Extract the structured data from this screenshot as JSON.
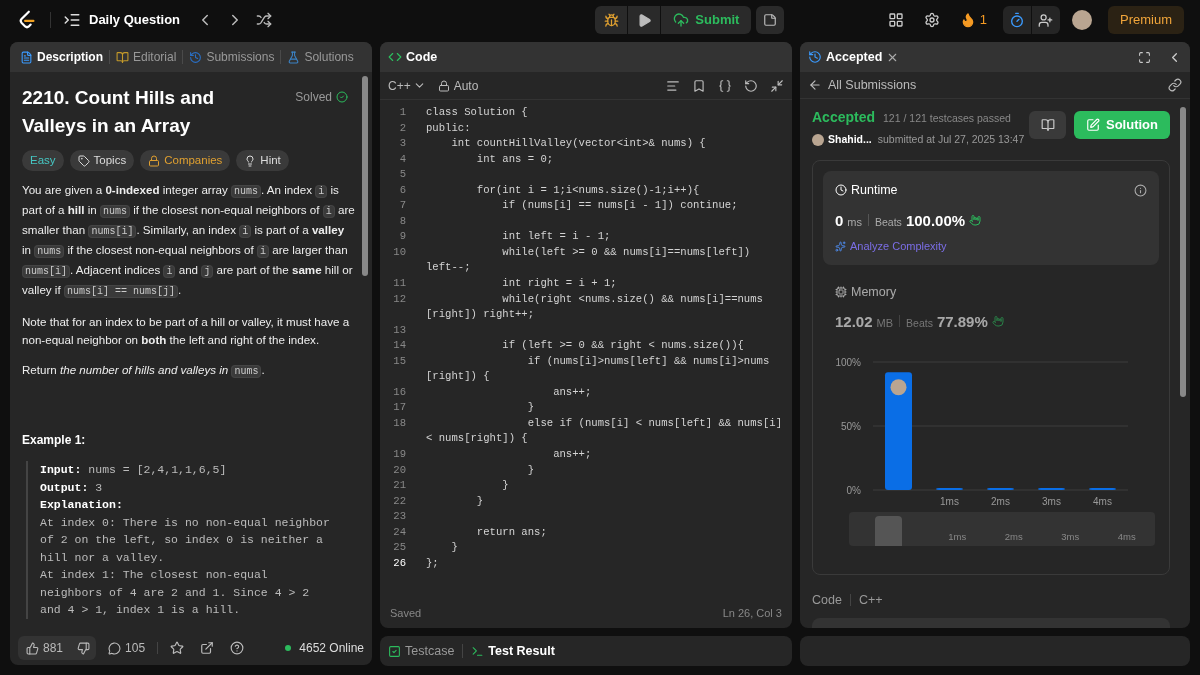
{
  "topbar": {
    "title": "Daily Question",
    "submit": "Submit",
    "streak": "1",
    "premium": "Premium"
  },
  "left_panel": {
    "tabs": [
      {
        "label": "Description",
        "kind": "description",
        "selected": true
      },
      {
        "label": "Editorial",
        "kind": "editorial",
        "selected": false
      },
      {
        "label": "Submissions",
        "kind": "submissions",
        "selected": false
      },
      {
        "label": "Solutions",
        "kind": "solutions",
        "selected": false
      }
    ],
    "title": "2210. Count Hills and Valleys in an Array",
    "status": "Solved",
    "tags": [
      {
        "label": "Easy",
        "kind": "difficulty"
      },
      {
        "label": "Topics",
        "kind": "topics"
      },
      {
        "label": "Companies",
        "kind": "companies"
      },
      {
        "label": "Hint",
        "kind": "hint"
      }
    ],
    "paragraphs": [
      [
        {
          "kind": "text",
          "text": "You are given a **0-indexed** integer array "
        },
        {
          "kind": "code",
          "text": "nums"
        },
        {
          "kind": "text",
          "text": ". An index "
        },
        {
          "kind": "code",
          "text": "i"
        },
        {
          "kind": "text",
          "text": " is part of a **hill** in "
        },
        {
          "kind": "code",
          "text": "nums"
        },
        {
          "kind": "text",
          "text": " if the closest non-equal neighbors of "
        },
        {
          "kind": "code",
          "text": "i"
        },
        {
          "kind": "text",
          "text": " are smaller than "
        },
        {
          "kind": "code",
          "text": "nums[i]"
        },
        {
          "kind": "text",
          "text": ". Similarly, an index "
        },
        {
          "kind": "code",
          "text": "i"
        },
        {
          "kind": "text",
          "text": " is part of a **valley** in "
        },
        {
          "kind": "code",
          "text": "nums"
        },
        {
          "kind": "text",
          "text": " if the closest non-equal neighbors of "
        },
        {
          "kind": "code",
          "text": "i"
        },
        {
          "kind": "text",
          "text": " are larger than "
        },
        {
          "kind": "code",
          "text": "nums[i]"
        },
        {
          "kind": "text",
          "text": ". Adjacent indices "
        },
        {
          "kind": "code",
          "text": "i"
        },
        {
          "kind": "text",
          "text": " and "
        },
        {
          "kind": "code",
          "text": "j"
        },
        {
          "kind": "text",
          "text": " are part of the **same** hill or valley if "
        },
        {
          "kind": "code",
          "text": "nums[i] == nums[j]"
        },
        {
          "kind": "text",
          "text": "."
        }
      ],
      [
        {
          "kind": "text",
          "text": "Note that for an index to be part of a hill or valley, it must have a non-equal neighbor on **both** the left and right of the index."
        }
      ],
      [
        {
          "kind": "text",
          "text": "Return *the number of hills and valleys in* "
        },
        {
          "kind": "code",
          "text": "nums"
        },
        {
          "kind": "text",
          "text": "."
        }
      ]
    ],
    "example_title": "Example 1:",
    "example_lines": [
      {
        "label": "Input:",
        "text": " nums = [2,4,1,1,6,5]"
      },
      {
        "label": "Output:",
        "text": " 3"
      },
      {
        "label": "Explanation:"
      },
      {
        "text": "At index 0: There is no non-equal neighbor"
      },
      {
        "text": "of 2 on the left, so index 0 is neither a"
      },
      {
        "text": "hill nor a valley."
      },
      {
        "text": "At index 1: The closest non-equal"
      },
      {
        "text": "neighbors of 4 are 2 and 1. Since 4 > 2"
      },
      {
        "text": "and 4 > 1, index 1 is a hill."
      }
    ],
    "footer": {
      "likes": "881",
      "comments": "105",
      "online": "4652 Online"
    }
  },
  "code_panel": {
    "title": "Code",
    "language": "C++",
    "mode": "Auto",
    "lines": [
      {
        "number": "1",
        "rows": [
          "class Solution {"
        ]
      },
      {
        "number": "2",
        "rows": [
          "public:"
        ]
      },
      {
        "number": "3",
        "rows": [
          "    int countHillValley(vector<int>& nums) {"
        ]
      },
      {
        "number": "4",
        "rows": [
          "        int ans = 0;"
        ]
      },
      {
        "number": "5"
      },
      {
        "number": "6",
        "rows": [
          "        for(int i = 1;i<nums.size()-1;i++){"
        ]
      },
      {
        "number": "7",
        "rows": [
          "            if (nums[i] == nums[i - 1]) continue;"
        ]
      },
      {
        "number": "8"
      },
      {
        "number": "9",
        "rows": [
          "            int left = i - 1;"
        ]
      },
      {
        "number": "10",
        "rows": [
          "            while(left >= 0 && nums[i]==nums[left])",
          "left--;"
        ]
      },
      {
        "number": "11",
        "rows": [
          "            int right = i + 1;"
        ]
      },
      {
        "number": "12",
        "rows": [
          "            while(right <nums.size() && nums[i]==nums",
          "[right]) right++;"
        ]
      },
      {
        "number": "13"
      },
      {
        "number": "14",
        "rows": [
          "            if (left >= 0 && right < nums.size()){"
        ]
      },
      {
        "number": "15",
        "rows": [
          "                if (nums[i]>nums[left] && nums[i]>nums",
          "[right]) {"
        ]
      },
      {
        "number": "16",
        "rows": [
          "                    ans++;"
        ]
      },
      {
        "number": "17",
        "rows": [
          "                }"
        ]
      },
      {
        "number": "18",
        "rows": [
          "                else if (nums[i] < nums[left] && nums[i]",
          "< nums[right]) {"
        ]
      },
      {
        "number": "19",
        "rows": [
          "                    ans++;"
        ]
      },
      {
        "number": "20",
        "rows": [
          "                }"
        ]
      },
      {
        "number": "21",
        "rows": [
          "            }"
        ]
      },
      {
        "number": "22",
        "rows": [
          "        }"
        ]
      },
      {
        "number": "23"
      },
      {
        "number": "24",
        "rows": [
          "        return ans;"
        ]
      },
      {
        "number": "25",
        "rows": [
          "    }"
        ]
      },
      {
        "number": "26",
        "rows": [
          "};"
        ]
      }
    ],
    "status": "Saved",
    "cursor": "Ln 26, Col 3",
    "bottom_tabs": [
      {
        "label": "Testcase",
        "kind": "testcase",
        "selected": false
      },
      {
        "label": "Test Result",
        "kind": "result",
        "selected": true
      }
    ]
  },
  "result_panel": {
    "tab": "Accepted",
    "back": "All Submissions",
    "verdict": "Accepted",
    "testcases": "121 / 121 testcases passed",
    "user": "Shahid...",
    "submitted": "submitted at Jul 27, 2025 13:47",
    "solution_button": "Solution",
    "metrics": [
      {
        "kind": "runtime",
        "label": "Runtime",
        "value": "0",
        "unit": "ms",
        "beats_label": "Beats",
        "beats": "100.00%",
        "selected": true,
        "action": "Analyze Complexity"
      },
      {
        "kind": "memory",
        "label": "Memory",
        "value": "12.02",
        "unit": "MB",
        "beats_label": "Beats",
        "beats": "77.89%",
        "selected": false
      }
    ],
    "chart_data": {
      "type": "bar",
      "categories": [
        null,
        "1ms",
        "2ms",
        "3ms",
        "4ms"
      ],
      "values": [
        92,
        1.5,
        1.5,
        1.5,
        1.5
      ],
      "ylim": [
        0,
        100
      ],
      "yticks": [
        {
          "value": 0,
          "label": "0%"
        },
        {
          "value": 50,
          "label": "50%"
        },
        {
          "value": 100,
          "label": "100%"
        }
      ]
    },
    "navigator_labels": [
      "1ms",
      "2ms",
      "3ms",
      "4ms"
    ],
    "code_label": "Code",
    "code_language": "C++"
  }
}
